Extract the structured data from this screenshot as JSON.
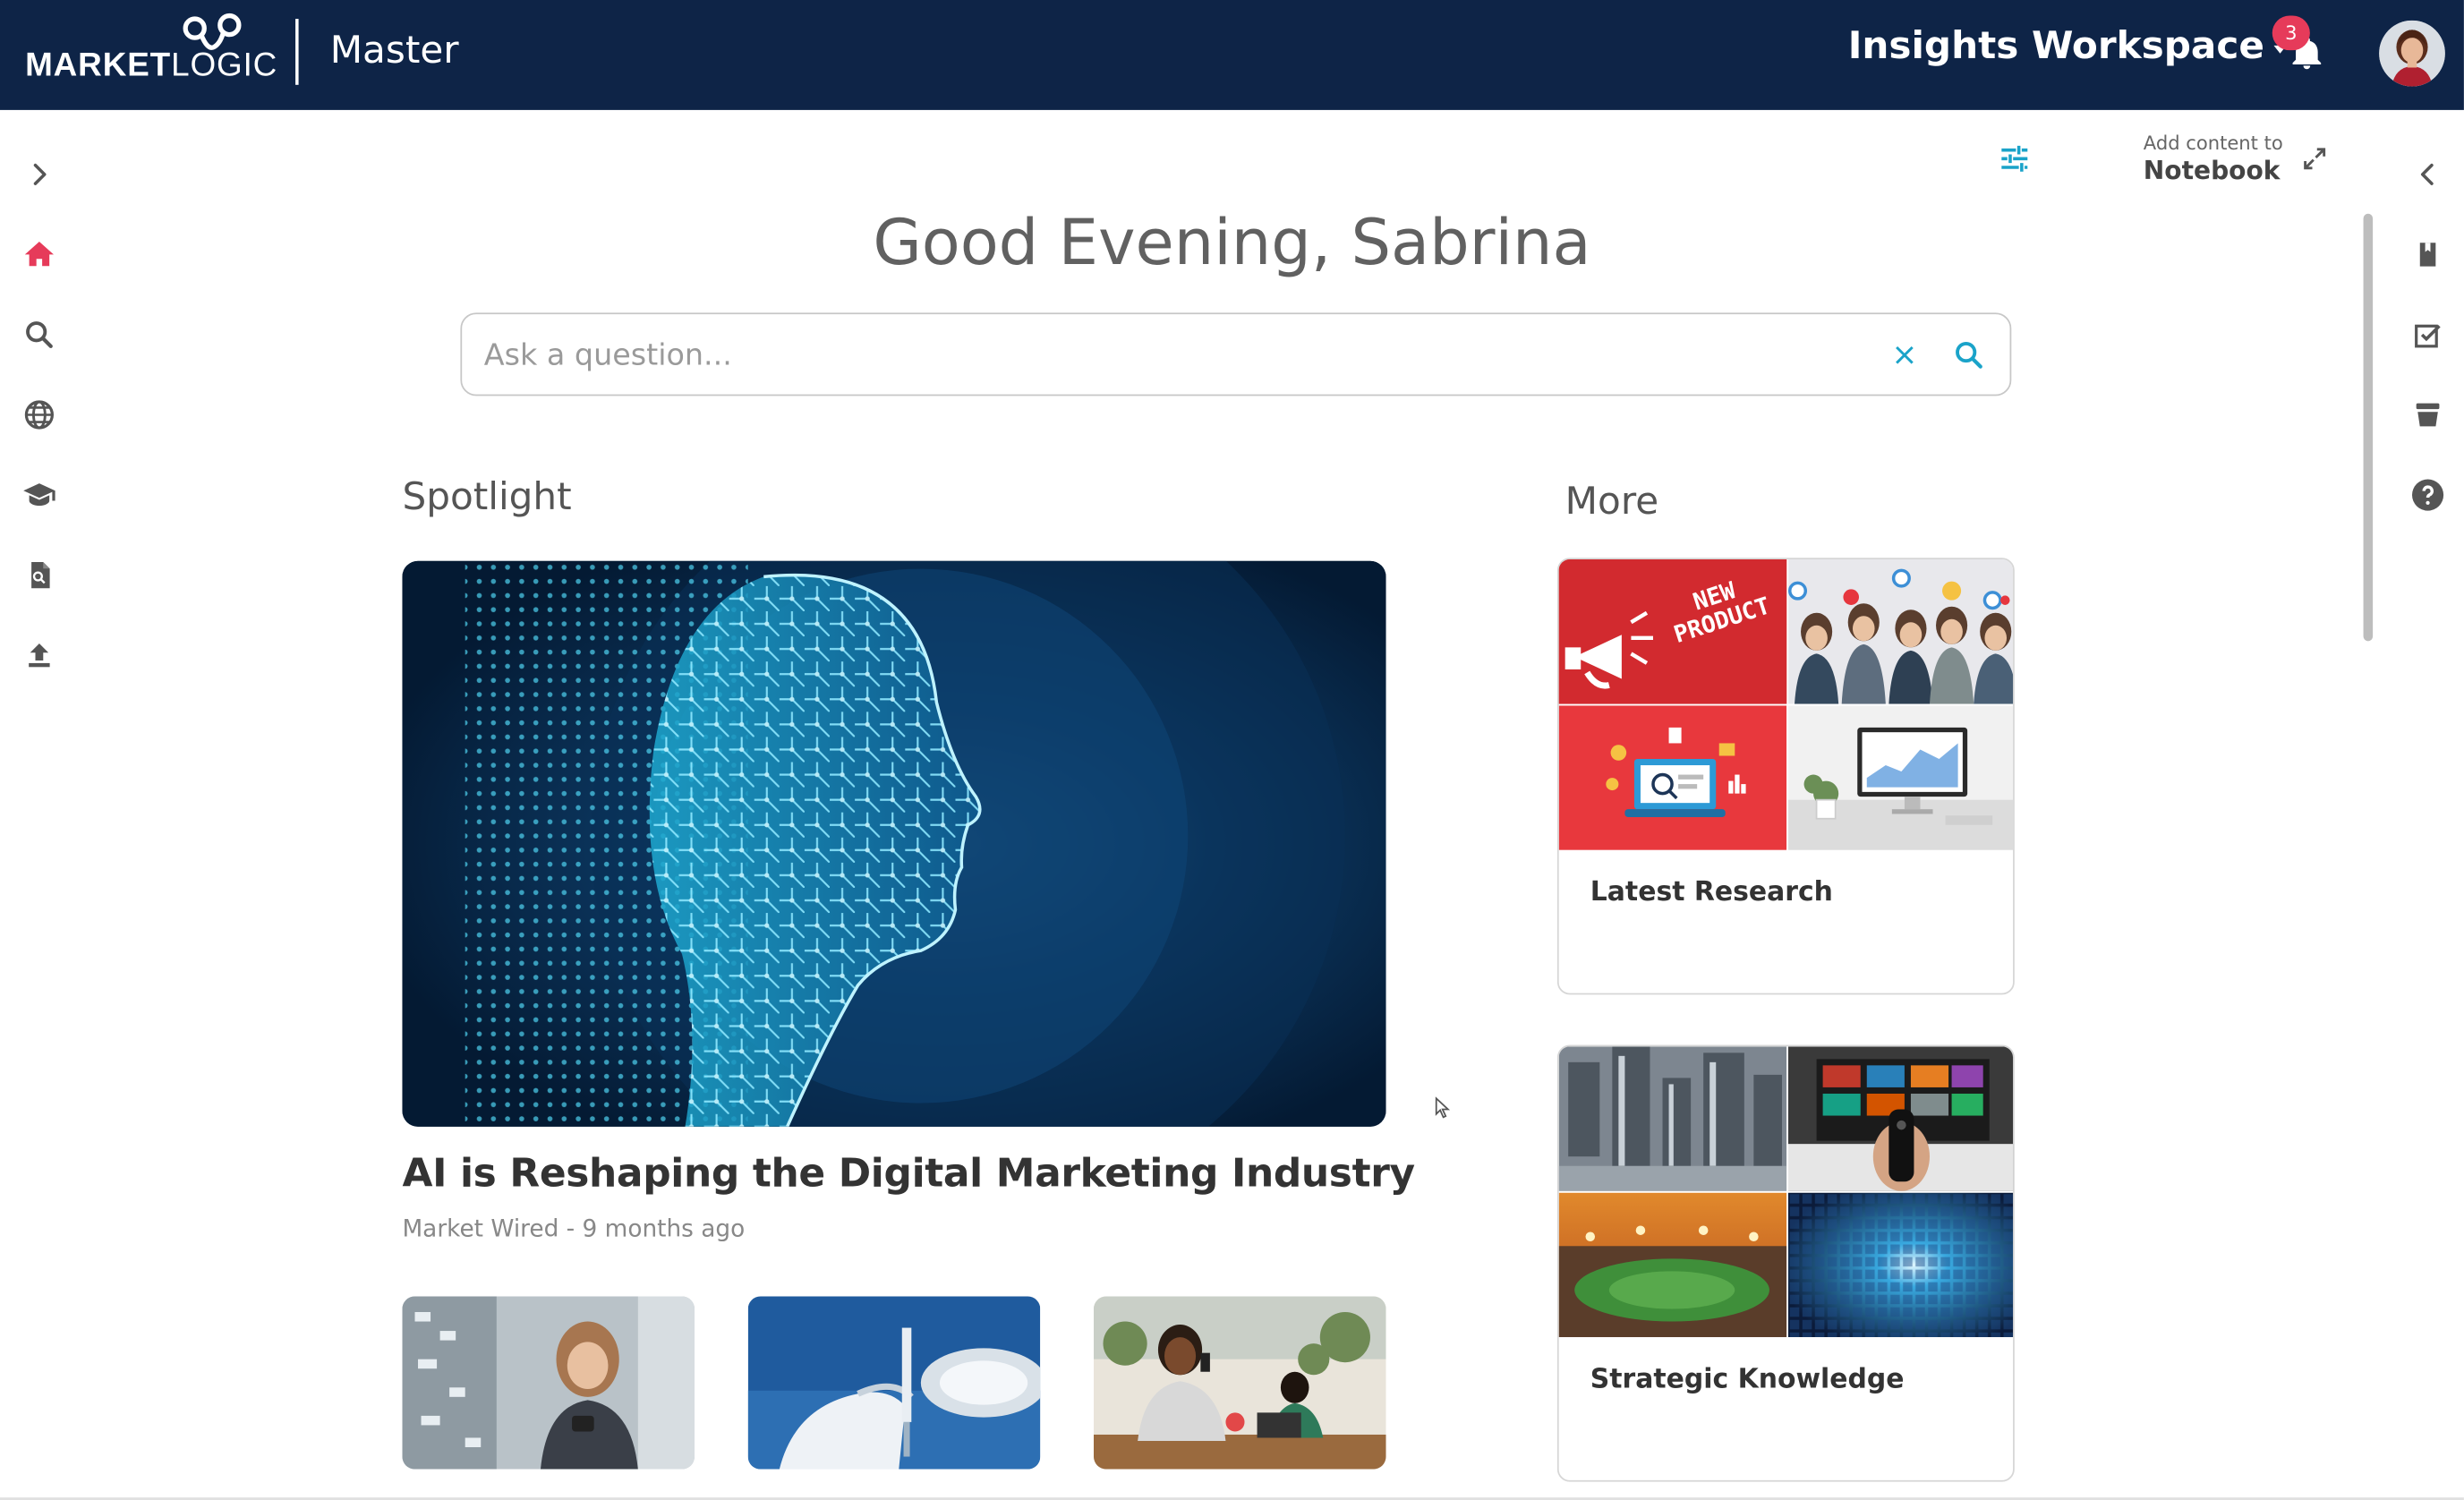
{
  "header": {
    "logo_bold": "MARKET",
    "logo_thin": "LOGIC",
    "app_title": "Master",
    "workspace": "Insights Workspace",
    "notification_count": "3"
  },
  "colors": {
    "topbar": "#0e2447",
    "accent": "#1aa3c9",
    "home_active": "#e63b5a",
    "badge": "#e63b5a"
  },
  "left_rail": {
    "icons": [
      "chevron-right-icon",
      "home-icon",
      "search-icon",
      "globe-icon",
      "graduation-cap-icon",
      "document-icon",
      "upload-icon"
    ]
  },
  "right_rail": {
    "icons": [
      "chevron-left-icon",
      "notebook-icon",
      "checklist-icon",
      "basket-icon",
      "help-icon"
    ]
  },
  "notebook": {
    "label": "Add content to",
    "name": "Notebook"
  },
  "greeting": "Good Evening, Sabrina",
  "search": {
    "placeholder": "Ask a question..."
  },
  "spotlight": {
    "title": "Spotlight",
    "hero_title": "AI is Reshaping the Digital Marketing Industry",
    "hero_meta": "Market Wired - 9 months ago"
  },
  "more": {
    "title": "More",
    "cards": [
      {
        "label": "Latest Research",
        "new_product_line1": "NEW",
        "new_product_line2": "PRODUCT"
      },
      {
        "label": "Strategic Knowledge"
      }
    ]
  }
}
